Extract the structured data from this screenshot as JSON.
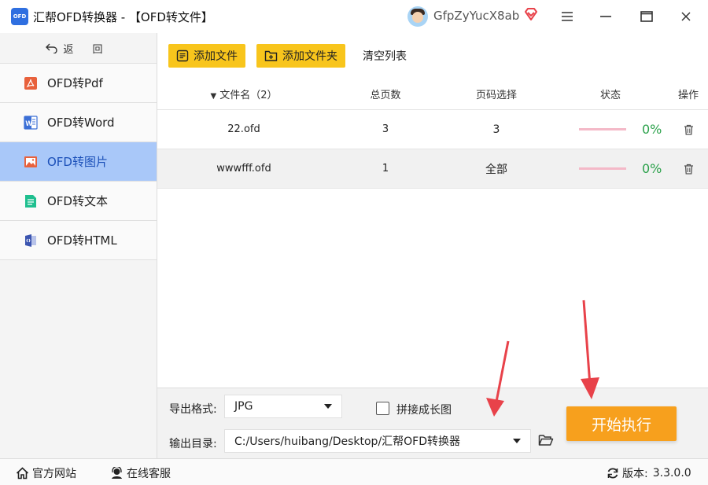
{
  "titlebar": {
    "logo_text": "OFD",
    "title": "汇帮OFD转换器 - 【OFD转文件】",
    "username": "GfpZyYucX8ab"
  },
  "sidebar": {
    "back_label": "返 回",
    "items": [
      {
        "label": "OFD转Pdf",
        "icon": "pdf-icon",
        "color": "#e8613c"
      },
      {
        "label": "OFD转Word",
        "icon": "word-icon",
        "color": "#3b6fd6"
      },
      {
        "label": "OFD转图片",
        "icon": "image-icon",
        "color": "#e8613c",
        "active": true
      },
      {
        "label": "OFD转文本",
        "icon": "text-icon",
        "color": "#1fbf8f"
      },
      {
        "label": "OFD转HTML",
        "icon": "html-icon",
        "color": "#3c55b0"
      }
    ]
  },
  "toolbar": {
    "add_file": "添加文件",
    "add_folder": "添加文件夹",
    "clear_list": "清空列表"
  },
  "table": {
    "headers": {
      "name": "文件名（2）",
      "pages": "总页数",
      "range": "页码选择",
      "status": "状态",
      "op": "操作"
    },
    "rows": [
      {
        "name": "22.ofd",
        "pages": "3",
        "range": "3",
        "progress": "0%"
      },
      {
        "name": "wwwfff.ofd",
        "pages": "1",
        "range": "全部",
        "progress": "0%"
      }
    ]
  },
  "bottom": {
    "format_label": "导出格式:",
    "format_value": "JPG",
    "merge_label": "拼接成长图",
    "output_label": "输出目录:",
    "output_value": "C:/Users/huibang/Desktop/汇帮OFD转换器",
    "start_label": "开始执行"
  },
  "statusbar": {
    "website": "官方网站",
    "support": "在线客服",
    "version_label": "版本:",
    "version": "3.3.0.0"
  },
  "colors": {
    "accent_yellow": "#f8c51c",
    "start_orange": "#f7a01d",
    "active_blue": "#a9c8f9",
    "progress_green": "#2aa14a",
    "annotation_red": "#e8424a"
  }
}
